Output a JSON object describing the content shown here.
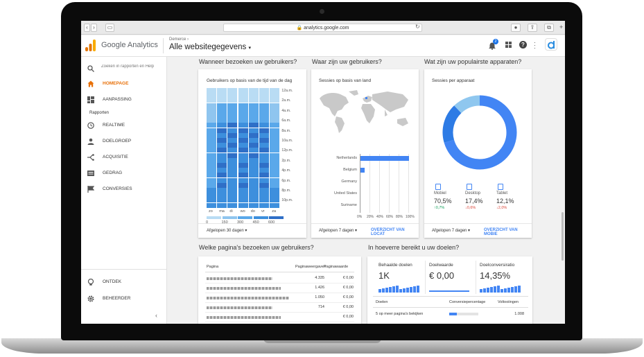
{
  "browser": {
    "url": "analytics.google.com",
    "lock": "lock-icon"
  },
  "header": {
    "product": "Google Analytics",
    "breadcrumb": "Demerce",
    "account": "Alle websitegegevens",
    "notification_count": "2"
  },
  "sidebar": {
    "search_placeholder": "Zoeken in rapporten en Help",
    "items": [
      {
        "label": "HOMEPAGE",
        "icon": "home-icon",
        "active": true
      },
      {
        "label": "AANPASSING",
        "icon": "dashboard-icon"
      }
    ],
    "section": "Rapporten",
    "reports": [
      {
        "label": "REALTIME",
        "icon": "clock-icon"
      },
      {
        "label": "DOELGROEP",
        "icon": "person-icon"
      },
      {
        "label": "ACQUISITIE",
        "icon": "acquisition-icon"
      },
      {
        "label": "GEDRAG",
        "icon": "behavior-icon"
      },
      {
        "label": "CONVERSIES",
        "icon": "flag-icon"
      }
    ],
    "bottom": [
      {
        "label": "ONTDEK",
        "icon": "lightbulb-icon"
      },
      {
        "label": "BEHEERDER",
        "icon": "gear-icon"
      }
    ]
  },
  "visits": {
    "section_title": "Wanneer bezoeken uw gebruikers?",
    "card_title": "Gebruikers op basis van de tijd van de dag",
    "hours": [
      "12a.m.",
      "2a.m.",
      "4a.m.",
      "6a.m.",
      "8a.m.",
      "10a.m.",
      "12p.m.",
      "2p.m.",
      "4p.m.",
      "6p.m.",
      "8p.m.",
      "10p.m."
    ],
    "days": [
      "zo",
      "ma",
      "di",
      "wo",
      "do",
      "vr",
      "za"
    ],
    "legend": [
      "0",
      "150",
      "300",
      "450",
      "600"
    ],
    "date_range": "Afgelopen 30 dagen"
  },
  "where": {
    "section_title": "Waar zijn uw gebruikers?",
    "card_title": "Sessies op basis van land",
    "countries": [
      "Netherlands",
      "Belgium",
      "Germany",
      "United States",
      "Suriname"
    ],
    "bar_share": [
      1.0,
      0.08,
      0.0,
      0.0,
      0.0
    ],
    "axis": [
      "0%",
      "20%",
      "40%",
      "60%",
      "80%",
      "100%"
    ],
    "date_range": "Afgelopen 7 dagen",
    "link": "OVERZICHT VAN LOCAT"
  },
  "devices": {
    "section_title": "Wat zijn uw populairste apparaten?",
    "card_title": "Sessies per apparaat",
    "items": [
      {
        "name": "Mobiel",
        "icon": "mobile-icon",
        "value": "70,5%",
        "change": "0,7%",
        "dir": "up",
        "color": "#4285f4"
      },
      {
        "name": "Desktop",
        "icon": "desktop-icon",
        "value": "17,4%",
        "change": "0,6%",
        "dir": "down",
        "color": "#2d7be5"
      },
      {
        "name": "Tablet",
        "icon": "tablet-icon",
        "value": "12,1%",
        "change": "2,0%",
        "dir": "down",
        "color": "#8fc7ef"
      }
    ],
    "date_range": "Afgelopen 7 dagen",
    "link": "OVERZICHT VAN MOBIE"
  },
  "pages": {
    "section_title": "Welke pagina's bezoeken uw gebruikers?",
    "col_page": "Pagina",
    "col_views": "Paginaweergaven",
    "col_value": "Paginawaarde",
    "rows": [
      {
        "views": "4.335",
        "value": "€ 0,00"
      },
      {
        "views": "1.426",
        "value": "€ 0,00"
      },
      {
        "views": "1.050",
        "value": "€ 0,00"
      },
      {
        "views": "714",
        "value": "€ 0,00"
      },
      {
        "views": "",
        "value": "€ 0,00"
      }
    ]
  },
  "goals": {
    "section_title": "In hoeverre bereikt u uw doelen?",
    "kpis": [
      {
        "label": "Behaalde doelen",
        "value": "1K"
      },
      {
        "label": "Doelwaarde",
        "value": "€ 0,00"
      },
      {
        "label": "Doelconversiratio",
        "value": "14,35%"
      }
    ],
    "col_goal": "Doelen",
    "col_rate": "Conversiepercentage",
    "col_done": "Voltooiingen",
    "rows": [
      {
        "name": "5 op meer pagina's bekijken",
        "rate": 0.25,
        "done": "1.008"
      }
    ]
  }
}
